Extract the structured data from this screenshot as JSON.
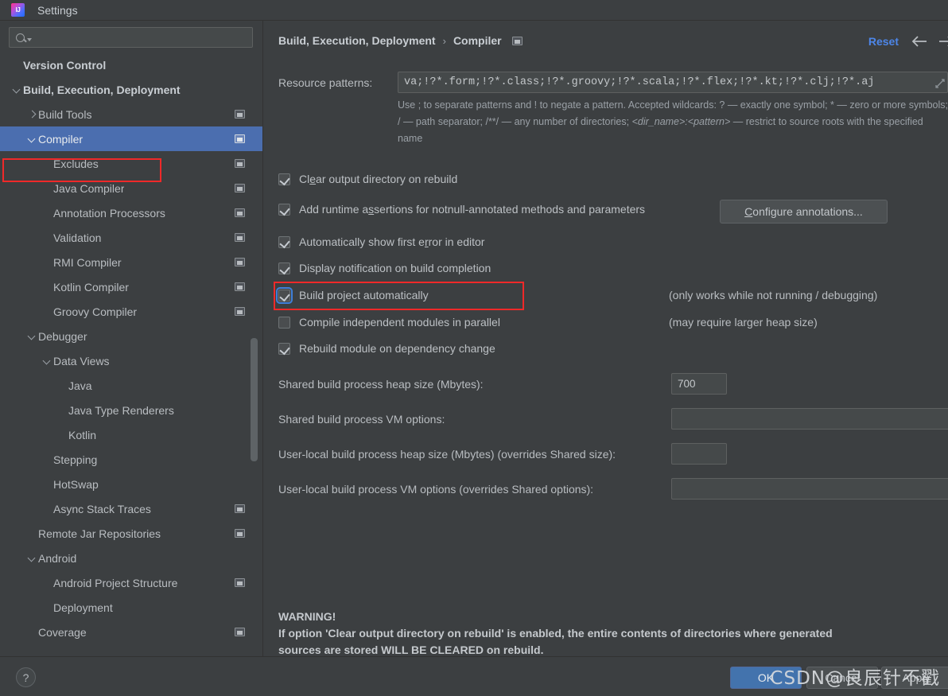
{
  "window": {
    "title": "Settings",
    "logo_icon": "intellij-idea-logo",
    "logo_text": "IJ"
  },
  "search": {
    "value": "",
    "placeholder": "",
    "icon": "search-icon"
  },
  "sidebar": {
    "items": [
      {
        "label": "Version Control",
        "indent": 0,
        "bold": true,
        "twisty": "none",
        "gear": false,
        "selected": false
      },
      {
        "label": "Build, Execution, Deployment",
        "indent": 0,
        "bold": true,
        "twisty": "down",
        "gear": false,
        "selected": false
      },
      {
        "label": "Build Tools",
        "indent": 1,
        "bold": false,
        "twisty": "right",
        "gear": true,
        "selected": false
      },
      {
        "label": "Compiler",
        "indent": 1,
        "bold": false,
        "twisty": "down",
        "gear": true,
        "selected": true
      },
      {
        "label": "Excludes",
        "indent": 2,
        "bold": false,
        "twisty": "none",
        "gear": true,
        "selected": false
      },
      {
        "label": "Java Compiler",
        "indent": 2,
        "bold": false,
        "twisty": "none",
        "gear": true,
        "selected": false
      },
      {
        "label": "Annotation Processors",
        "indent": 2,
        "bold": false,
        "twisty": "none",
        "gear": true,
        "selected": false
      },
      {
        "label": "Validation",
        "indent": 2,
        "bold": false,
        "twisty": "none",
        "gear": true,
        "selected": false
      },
      {
        "label": "RMI Compiler",
        "indent": 2,
        "bold": false,
        "twisty": "none",
        "gear": true,
        "selected": false
      },
      {
        "label": "Kotlin Compiler",
        "indent": 2,
        "bold": false,
        "twisty": "none",
        "gear": true,
        "selected": false
      },
      {
        "label": "Groovy Compiler",
        "indent": 2,
        "bold": false,
        "twisty": "none",
        "gear": true,
        "selected": false
      },
      {
        "label": "Debugger",
        "indent": 1,
        "bold": false,
        "twisty": "down",
        "gear": false,
        "selected": false
      },
      {
        "label": "Data Views",
        "indent": 2,
        "bold": false,
        "twisty": "down",
        "gear": false,
        "selected": false
      },
      {
        "label": "Java",
        "indent": 3,
        "bold": false,
        "twisty": "none",
        "gear": false,
        "selected": false
      },
      {
        "label": "Java Type Renderers",
        "indent": 3,
        "bold": false,
        "twisty": "none",
        "gear": false,
        "selected": false
      },
      {
        "label": "Kotlin",
        "indent": 3,
        "bold": false,
        "twisty": "none",
        "gear": false,
        "selected": false
      },
      {
        "label": "Stepping",
        "indent": 2,
        "bold": false,
        "twisty": "none",
        "gear": false,
        "selected": false
      },
      {
        "label": "HotSwap",
        "indent": 2,
        "bold": false,
        "twisty": "none",
        "gear": false,
        "selected": false
      },
      {
        "label": "Async Stack Traces",
        "indent": 2,
        "bold": false,
        "twisty": "none",
        "gear": true,
        "selected": false
      },
      {
        "label": "Remote Jar Repositories",
        "indent": 1,
        "bold": false,
        "twisty": "none",
        "gear": true,
        "selected": false
      },
      {
        "label": "Android",
        "indent": 1,
        "bold": false,
        "twisty": "down",
        "gear": false,
        "selected": false
      },
      {
        "label": "Android Project Structure",
        "indent": 2,
        "bold": false,
        "twisty": "none",
        "gear": true,
        "selected": false
      },
      {
        "label": "Deployment",
        "indent": 2,
        "bold": false,
        "twisty": "none",
        "gear": false,
        "selected": false
      },
      {
        "label": "Coverage",
        "indent": 1,
        "bold": false,
        "twisty": "none",
        "gear": true,
        "selected": false
      }
    ]
  },
  "header": {
    "breadcrumb_parent": "Build, Execution, Deployment",
    "breadcrumb_separator": "›",
    "breadcrumb_current": "Compiler",
    "page_icon": "window-settings-icon",
    "reset_label": "Reset",
    "back_icon": "arrow-left-icon",
    "forward_icon": "arrow-right-icon"
  },
  "resource_patterns": {
    "label": "Resource patterns:",
    "value": "va;!?*.form;!?*.class;!?*.groovy;!?*.scala;!?*.flex;!?*.kt;!?*.clj;!?*.aj",
    "expand_icon": "expand-textarea-icon",
    "hint_part1": "Use ; to separate patterns and ! to negate a pattern. Accepted wildcards: ? — exactly one symbol; * — zero or more symbols; / — path separator; /**/ — any number of directories; ",
    "hint_italic": "<dir_name>:<pattern>",
    "hint_part2": " — restrict to source roots with the specified name"
  },
  "options": [
    {
      "label": "Clear output directory on rebuild",
      "checked": true,
      "focused": false
    },
    {
      "label": "Add runtime assertions for notnull-annotated methods and parameters",
      "checked": true,
      "focused": false
    },
    {
      "label": "Automatically show first error in editor",
      "checked": true,
      "focused": false
    },
    {
      "label": "Display notification on build completion",
      "checked": true,
      "focused": false
    },
    {
      "label": "Build project automatically",
      "checked": true,
      "focused": true
    },
    {
      "label": "Compile independent modules in parallel",
      "checked": false,
      "focused": false
    },
    {
      "label": "Rebuild module on dependency change",
      "checked": true,
      "focused": false
    }
  ],
  "configure_button": "Configure annotations...",
  "notes": {
    "build_auto": "(only works while not running / debugging)",
    "parallel": "(may require larger heap size)"
  },
  "fields": [
    {
      "label": "Shared build process heap size (Mbytes):",
      "value": "700",
      "expand": false
    },
    {
      "label": "Shared build process VM options:",
      "value": "",
      "expand": true
    },
    {
      "label": "User-local build process heap size (Mbytes) (overrides Shared size):",
      "value": "",
      "expand": false
    },
    {
      "label": "User-local build process VM options (overrides Shared options):",
      "value": "",
      "expand": true
    }
  ],
  "warning": {
    "title": "WARNING!",
    "line1": "If option 'Clear output directory on rebuild' is enabled, the entire contents of directories where generated",
    "line2": "sources are stored WILL BE CLEARED on rebuild."
  },
  "footer": {
    "help_icon": "help-question-icon",
    "ok": "OK",
    "cancel": "Cancel",
    "apply": "Apply"
  },
  "watermark": "CSDN@良辰针不戳",
  "colors": {
    "window_bg": "#3c3f41",
    "selection_blue": "#4b6eaf",
    "accent_link": "#4d86e8",
    "ok_button": "#4373ad",
    "highlight_red": "#ef2929",
    "focus_ring": "#3f7fd9",
    "text": "#bbbbbb"
  }
}
